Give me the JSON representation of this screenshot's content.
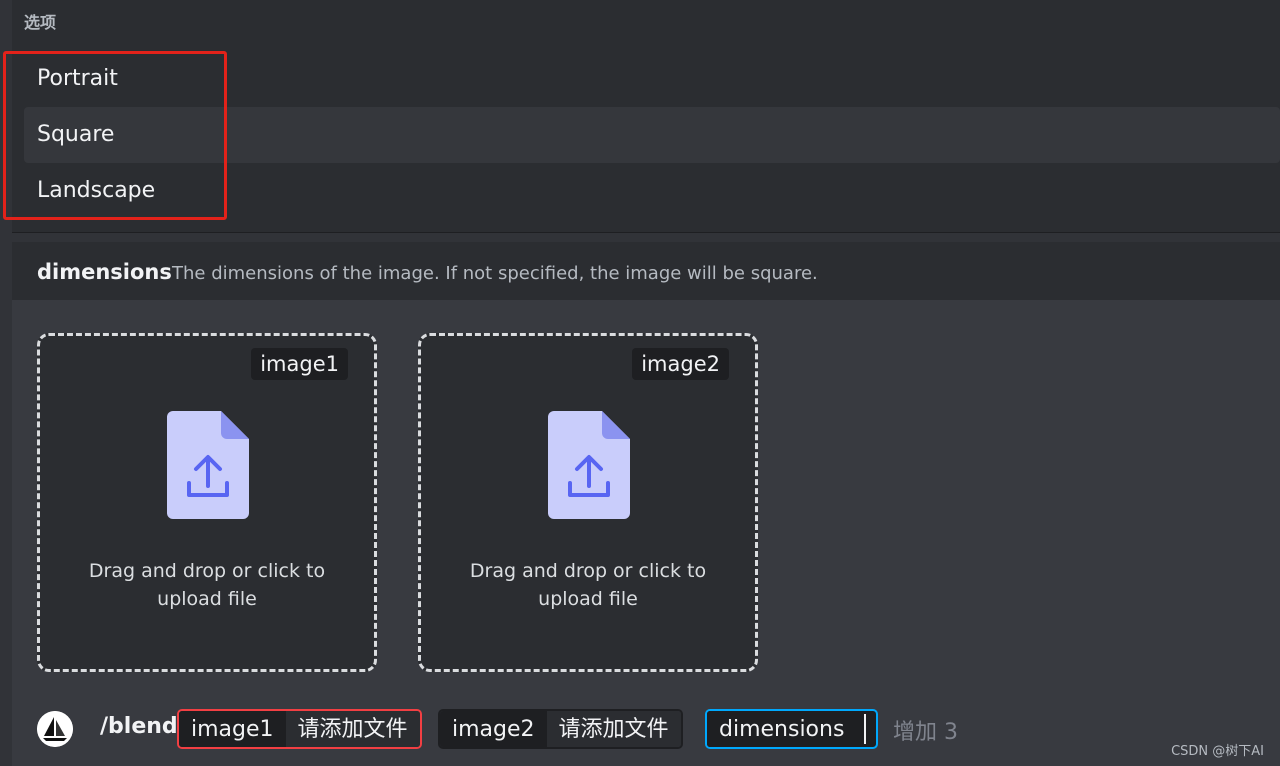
{
  "options_popup": {
    "header": "选项",
    "items": [
      {
        "label": "Portrait"
      },
      {
        "label": "Square"
      },
      {
        "label": "Landscape"
      }
    ]
  },
  "option_hint": {
    "name": "dimensions",
    "description": "The dimensions of the image. If not specified, the image will be square."
  },
  "uploads": [
    {
      "tag": "image1",
      "text_line1": "Drag and drop or click to",
      "text_line2": "upload file"
    },
    {
      "tag": "image2",
      "text_line1": "Drag and drop or click to",
      "text_line2": "upload file"
    }
  ],
  "command_bar": {
    "command": "/blend",
    "chips": [
      {
        "key": "image1",
        "value": "请添加文件"
      },
      {
        "key": "image2",
        "value": "请添加文件"
      },
      {
        "key": "dimensions"
      }
    ],
    "add_more": "增加 3",
    "watermark": "CSDN @树下AI"
  },
  "colors": {
    "accent_red": "#f23f43",
    "highlight_box": "#e3221a",
    "focus_blue": "#00a8fc",
    "upload_icon": "#5865f2"
  }
}
